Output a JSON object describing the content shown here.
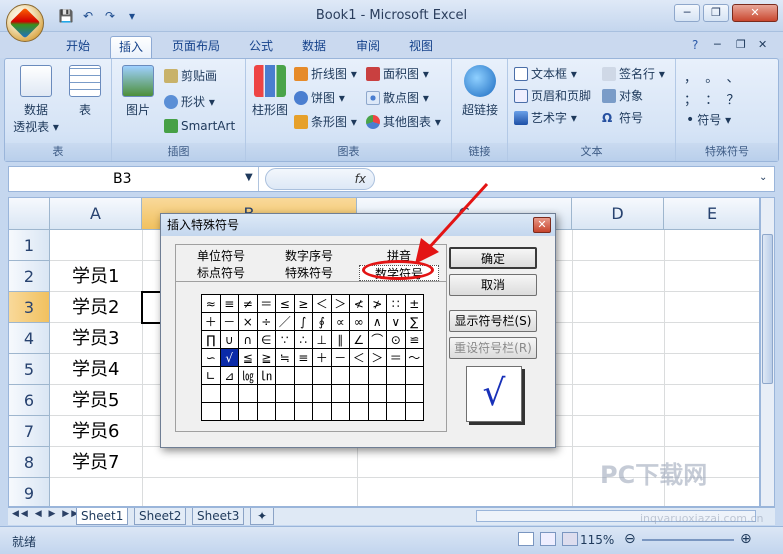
{
  "window": {
    "title": "Book1 - Microsoft Excel",
    "controls": [
      "─",
      "❐",
      "✕"
    ],
    "inner_controls": [
      "?",
      "─",
      "❐",
      "✕"
    ]
  },
  "qat": {
    "icons": [
      "save-icon",
      "undo-icon",
      "redo-icon",
      "customize-icon"
    ],
    "glyphs": [
      "💾",
      "↶",
      "↷",
      "▾"
    ]
  },
  "tabs": [
    "开始",
    "插入",
    "页面布局",
    "公式",
    "数据",
    "审阅",
    "视图"
  ],
  "active_tab": "插入",
  "ribbon": {
    "groups": {
      "tables": {
        "title": "表",
        "pivot": "数据",
        "pivot2": "透视表 ▾",
        "table": "表"
      },
      "illustrations": {
        "title": "插图",
        "picture": "图片",
        "clipart": "剪贴画",
        "shapes": "形状 ▾",
        "smartart": "SmartArt"
      },
      "charts": {
        "title": "图表",
        "column": "柱形图",
        "line": "折线图 ▾",
        "pie": "饼图 ▾",
        "bar": "条形图 ▾",
        "area": "面积图 ▾",
        "scatter": "散点图 ▾",
        "other": "其他图表 ▾"
      },
      "links": {
        "title": "链接",
        "hyperlink": "超链接"
      },
      "text": {
        "title": "文本",
        "textbox": "文本框 ▾",
        "header": "页眉和页脚",
        "wordart": "艺术字 ▾",
        "signature": "签名行 ▾",
        "object": "对象",
        "symbol": "符号"
      },
      "special": {
        "title": "特殊符号",
        "row1": "，  。  、",
        "row2": "；  ：  ？",
        "symbol": "符号 ▾"
      }
    }
  },
  "formula_bar": {
    "name_box": "B3",
    "fx": "fx"
  },
  "grid": {
    "columns": [
      "A",
      "B",
      "C",
      "D",
      "E"
    ],
    "rows": [
      "1",
      "2",
      "3",
      "4",
      "5",
      "6",
      "7",
      "8",
      "9"
    ],
    "cells_A": [
      "",
      "学员1",
      "学员2",
      "学员3",
      "学员4",
      "学员5",
      "学员6",
      "学员7",
      ""
    ]
  },
  "sheets": [
    "Sheet1",
    "Sheet2",
    "Sheet3"
  ],
  "status": {
    "left": "就绪",
    "zoom": "115%"
  },
  "dialog": {
    "title": "插入特殊符号",
    "tabs_row1": [
      "单位符号",
      "数字序号",
      "拼音"
    ],
    "tabs_row2": [
      "标点符号",
      "特殊符号",
      "数学符号"
    ],
    "active_tab": "数学符号",
    "symbols": [
      [
        "≈",
        "≡",
        "≠",
        "＝",
        "≤",
        "≥",
        "＜",
        "＞",
        "≮",
        "≯",
        "∷",
        "±"
      ],
      [
        "＋",
        "－",
        "×",
        "÷",
        "／",
        "∫",
        "∮",
        "∝",
        "∞",
        "∧",
        "∨",
        "∑"
      ],
      [
        "∏",
        "∪",
        "∩",
        "∈",
        "∵",
        "∴",
        "⊥",
        "∥",
        "∠",
        "⌒",
        "⊙",
        "≌"
      ],
      [
        "∽",
        "√",
        "≦",
        "≧",
        "≒",
        "≡",
        "＋",
        "－",
        "＜",
        "＞",
        "＝",
        "～"
      ],
      [
        "∟",
        "⊿",
        "㏒",
        "㏑",
        "",
        "",
        "",
        "",
        "",
        "",
        "",
        ""
      ],
      [
        "",
        "",
        "",
        "",
        "",
        "",
        "",
        "",
        "",
        "",
        "",
        ""
      ],
      [
        "",
        "",
        "",
        "",
        "",
        "",
        "",
        "",
        "",
        "",
        "",
        ""
      ]
    ],
    "buttons": {
      "ok": "确定",
      "cancel": "取消",
      "show": "显示符号栏(S)",
      "reset": "重设符号栏(R)"
    },
    "preview": "√"
  },
  "watermark": {
    "main": "PC下载网",
    "sub": "inqvaruoxiazai.com.cn"
  }
}
